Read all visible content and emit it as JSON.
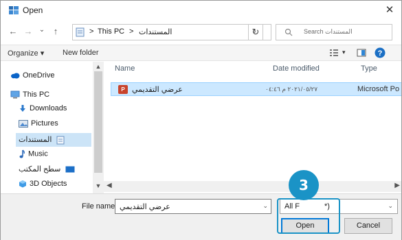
{
  "window": {
    "title": "Open",
    "close_glyph": "✕"
  },
  "navigation": {
    "back_glyph": "←",
    "forward_glyph": "→",
    "recent_glyph": "⌄",
    "up_glyph": "↑",
    "breadcrumbs": [
      "This PC",
      "المستندات"
    ],
    "separator": ">",
    "refresh_glyph": "↻"
  },
  "search": {
    "placeholder": "Search المستندات"
  },
  "toolbar": {
    "organize_label": "Organize ▾",
    "new_folder_label": "New folder"
  },
  "sidebar": {
    "items": [
      {
        "label": "OneDrive",
        "icon": "cloud-icon"
      },
      {
        "label": "This PC",
        "icon": "computer-icon"
      },
      {
        "label": "Downloads",
        "icon": "download-icon"
      },
      {
        "label": "Pictures",
        "icon": "pictures-icon"
      },
      {
        "label": "المستندات",
        "icon": "documents-icon"
      },
      {
        "label": "Music",
        "icon": "music-icon"
      },
      {
        "label": "سطح المكتب",
        "icon": "desktop-icon"
      },
      {
        "label": "3D Objects",
        "icon": "3d-objects-icon"
      }
    ],
    "selected_index": 4
  },
  "file_list": {
    "columns": [
      "Name",
      "Date modified",
      "Type"
    ],
    "rows": [
      {
        "name": "عرضي التقديمي",
        "date": "٢٠٢١/٠٥/٢٧ م ٠٤:٤٦",
        "type": "Microsoft Po",
        "icon": "powerpoint-file-icon",
        "selected": true
      }
    ]
  },
  "bottom": {
    "file_name_label": "File name:",
    "file_name_value": "عرضي التقديمي",
    "file_type_value": "All F",
    "file_type_suffix": "*)",
    "open_label": "Open",
    "cancel_label": "Cancel"
  },
  "callout": {
    "step_number": "3"
  },
  "colors": {
    "accent": "#0078d7",
    "selection": "#cce8ff",
    "callout": "#1a93c6"
  }
}
